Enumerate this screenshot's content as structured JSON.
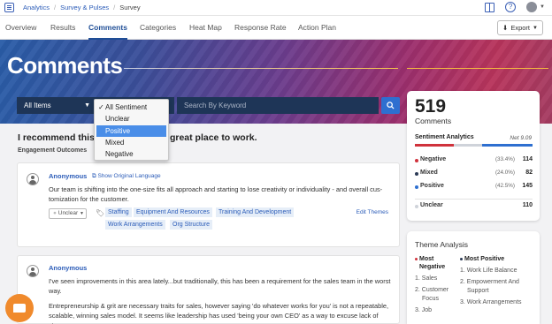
{
  "breadcrumb": {
    "items": [
      "Analytics",
      "Survey & Pulses",
      "Survey"
    ]
  },
  "tabs": [
    {
      "label": "Overview"
    },
    {
      "label": "Results"
    },
    {
      "label": "Comments",
      "active": true
    },
    {
      "label": "Categories"
    },
    {
      "label": "Heat Map"
    },
    {
      "label": "Response Rate"
    },
    {
      "label": "Action Plan"
    }
  ],
  "export_label": "Export",
  "hero": {
    "title": "Comments"
  },
  "filters": {
    "items_selected": "All Items",
    "search_placeholder": "Search By Keyword",
    "sentiment_options": [
      "All Sentiment",
      "Unclear",
      "Positive",
      "Mixed",
      "Negative"
    ],
    "sentiment_checked": "All Sentiment",
    "sentiment_highlighted": "Positive"
  },
  "question": {
    "text_start": "I recommend this",
    "text_end": "great place to work.",
    "subtitle": "Engagement Outcomes"
  },
  "comments": [
    {
      "author": "Anonymous",
      "original_language_link": "Show Original Language",
      "text_lines": [
        "Our team is shifting into the one-size fits all approach and starting to lose creativity or individuality - and overall cus-",
        "tomization for the customer."
      ],
      "sentiment": "Unclear",
      "tags": [
        "Staffing",
        "Equipment And Resources",
        "Training And Development",
        "Work Arrangements",
        "Org Structure"
      ],
      "edit_themes": "Edit Themes"
    },
    {
      "author": "Anonymous",
      "text_lines": [
        "I've seen improvements in this area lately...but traditionally, this has been a requirement for the sales team in the worst",
        "way.",
        "Entrepreneurship & grit are necessary traits for sales, however saying 'do whatever works for you' is not a repeatable,",
        "scalable, winning sales model. It seems like leadership has used 'being your own CEO' as a way to excuse lack of struc-"
      ]
    }
  ],
  "stats": {
    "total": "519",
    "total_label": "Comments",
    "sentiment_title": "Sentiment Analytics",
    "net": "Net 9.09",
    "bar_fractions": {
      "negative": 0.334,
      "mixed": 0.24,
      "positive": 0.425
    },
    "rows": [
      {
        "label": "Negative",
        "pct": "(33.4%)",
        "count": "114",
        "color": "#d0323c"
      },
      {
        "label": "Mixed",
        "pct": "(24.0%)",
        "count": "82",
        "color": "#2b3a55"
      },
      {
        "label": "Positive",
        "pct": "(42.5%)",
        "count": "145",
        "color": "#2e6fd0"
      },
      {
        "label": "Unclear",
        "pct": "",
        "count": "110",
        "color": "#cfd3da"
      }
    ]
  },
  "theme_analysis": {
    "title": "Theme Analysis",
    "most_negative": {
      "title_line1": "Most",
      "title_line2": "Negative",
      "items": [
        "1. Sales",
        "2. Customer",
        "Focus",
        "3. Job"
      ]
    },
    "most_positive": {
      "title": "Most Positive",
      "items": [
        "1. Work Life Balance",
        "2. Empowerment And",
        "Support",
        "3. Work Arrangements"
      ]
    }
  }
}
